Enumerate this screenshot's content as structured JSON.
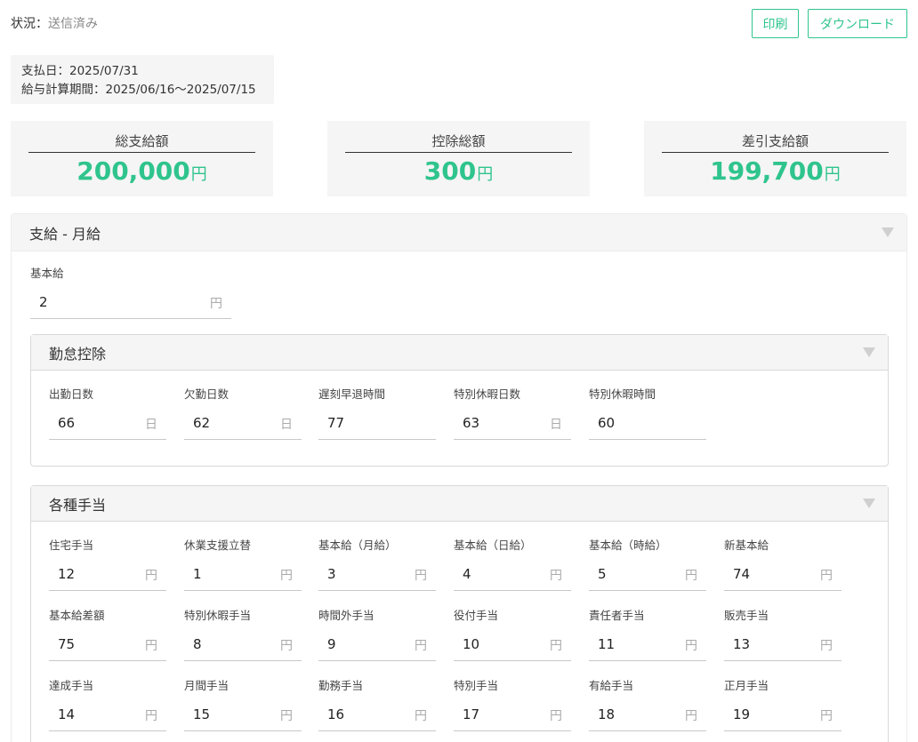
{
  "status": {
    "label": "状況：",
    "value": "送信済み"
  },
  "toolbar": {
    "print_label": "印刷",
    "download_label": "ダウンロード"
  },
  "payment": {
    "date_line": "支払日：2025/07/31",
    "period_line": "給与計算期間：2025/06/16〜2025/07/15"
  },
  "summary": [
    {
      "label": "総支給額",
      "value": "200,000",
      "unit": "円"
    },
    {
      "label": "控除総額",
      "value": "300",
      "unit": "円"
    },
    {
      "label": "差引支給額",
      "value": "199,700",
      "unit": "円"
    }
  ],
  "section": {
    "title": "支給 - 月給",
    "base_pay": {
      "label": "基本給",
      "value": "2",
      "unit": "円"
    },
    "attendance": {
      "title": "勤怠控除",
      "fields": [
        {
          "label": "出勤日数",
          "value": "66",
          "unit": "日"
        },
        {
          "label": "欠勤日数",
          "value": "62",
          "unit": "日"
        },
        {
          "label": "遅刻早退時間",
          "value": "77",
          "unit": ""
        },
        {
          "label": "特別休暇日数",
          "value": "63",
          "unit": "日"
        },
        {
          "label": "特別休暇時間",
          "value": "60",
          "unit": ""
        }
      ]
    },
    "allowances": {
      "title": "各種手当",
      "fields": [
        {
          "label": "住宅手当",
          "value": "12",
          "unit": "円"
        },
        {
          "label": "休業支援立替",
          "value": "1",
          "unit": "円"
        },
        {
          "label": "基本給（月給）",
          "value": "3",
          "unit": "円"
        },
        {
          "label": "基本給（日給）",
          "value": "4",
          "unit": "円"
        },
        {
          "label": "基本給（時給）",
          "value": "5",
          "unit": "円"
        },
        {
          "label": "新基本給",
          "value": "74",
          "unit": "円"
        },
        {
          "label": "基本給差額",
          "value": "75",
          "unit": "円"
        },
        {
          "label": "特別休暇手当",
          "value": "8",
          "unit": "円"
        },
        {
          "label": "時間外手当",
          "value": "9",
          "unit": "円"
        },
        {
          "label": "役付手当",
          "value": "10",
          "unit": "円"
        },
        {
          "label": "責任者手当",
          "value": "11",
          "unit": "円"
        },
        {
          "label": "販売手当",
          "value": "13",
          "unit": "円"
        },
        {
          "label": "達成手当",
          "value": "14",
          "unit": "円"
        },
        {
          "label": "月間手当",
          "value": "15",
          "unit": "円"
        },
        {
          "label": "勤務手当",
          "value": "16",
          "unit": "円"
        },
        {
          "label": "特別手当",
          "value": "17",
          "unit": "円"
        },
        {
          "label": "有給手当",
          "value": "18",
          "unit": "円"
        },
        {
          "label": "正月手当",
          "value": "19",
          "unit": "円"
        }
      ]
    }
  },
  "colors": {
    "accent": "#2fc48d",
    "panel_bg": "#f5f5f5",
    "unit_gray": "#aaaaaa"
  }
}
